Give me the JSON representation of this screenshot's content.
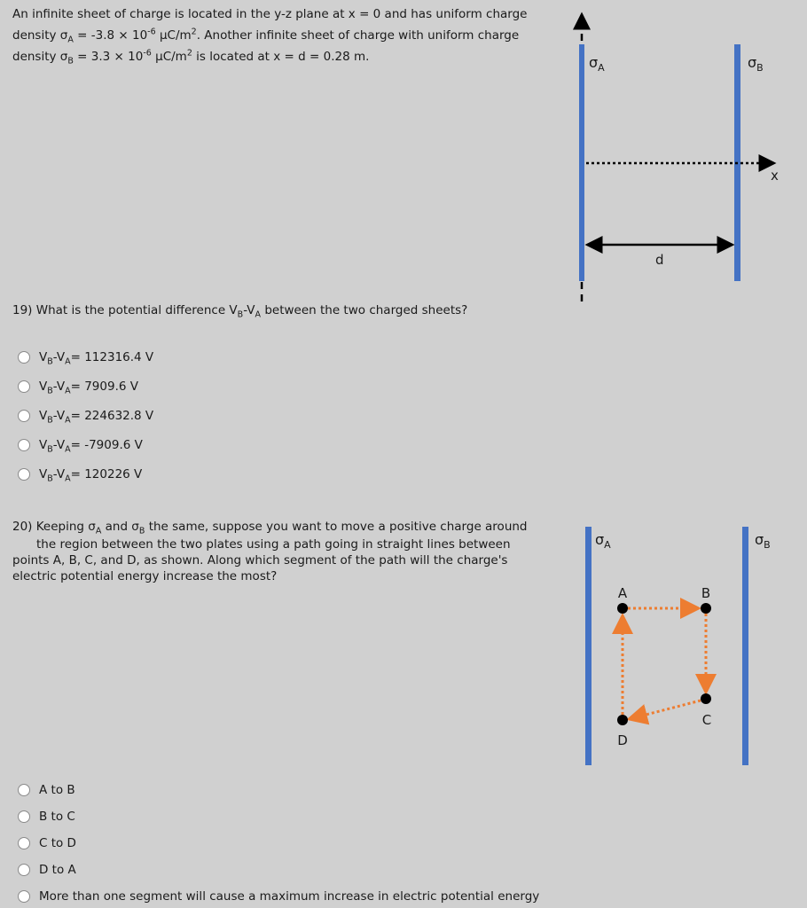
{
  "intro": {
    "line1": "An infinite sheet of charge is located in the y-z plane at x = 0 and has uniform charge",
    "l2_a": "density σ",
    "l2_sub": "A",
    "l2_b": " = -3.8 × 10",
    "l2_sup": "-6",
    "l2_c": " μC/m",
    "l2_sup2": "2",
    "l2_d": ". Another infinite sheet of charge with uniform charge",
    "l3_a": "density σ",
    "l3_sub": "B",
    "l3_b": " = 3.3 × 10",
    "l3_sup": "-6",
    "l3_c": " μC/m",
    "l3_sup2": "2",
    "l3_d": " is located at x = d = 0.28 m."
  },
  "diagram1": {
    "sigma": "σ",
    "sub_a": "A",
    "sub_b": "B",
    "x_label": "x",
    "d_label": "d",
    "plate_color": "#4472c4"
  },
  "q19": {
    "text_a": "19) What is the potential difference V",
    "sub_b": "B",
    "dash": "-V",
    "sub_a": "A",
    "text_b": " between the two charged sheets?",
    "options": [
      {
        "pre": "V",
        "s1": "B",
        "mid": "-V",
        "s2": "A",
        "val": "= 112316.4 V"
      },
      {
        "pre": "V",
        "s1": "B",
        "mid": "-V",
        "s2": "A",
        "val": "= 7909.6 V"
      },
      {
        "pre": "V",
        "s1": "B",
        "mid": "-V",
        "s2": "A",
        "val": "= 224632.8 V"
      },
      {
        "pre": "V",
        "s1": "B",
        "mid": "-V",
        "s2": "A",
        "val": "= -7909.6 V"
      },
      {
        "pre": "V",
        "s1": "B",
        "mid": "-V",
        "s2": "A",
        "val": "= 120226 V"
      }
    ]
  },
  "q20": {
    "l1_a": "20) Keeping σ",
    "l1_s1": "A",
    "l1_b": " and σ",
    "l1_s2": "B",
    "l1_c": " the same, suppose you want to move a positive charge around",
    "line2": "the region between the two plates using a path going in straight lines between",
    "line3": "points A, B, C, and D, as shown. Along which segment of the path will the charge's",
    "line4": "electric potential energy increase the most?",
    "options": [
      "A to B",
      "B to C",
      "C to D",
      "D to A",
      "More than one segment will cause a maximum increase in electric potential energy"
    ]
  },
  "diagram2": {
    "sigma": "σ",
    "sub_a": "A",
    "sub_b": "B",
    "points": [
      "A",
      "B",
      "C",
      "D"
    ],
    "path_color": "#ed7d31",
    "plate_color": "#4472c4"
  }
}
